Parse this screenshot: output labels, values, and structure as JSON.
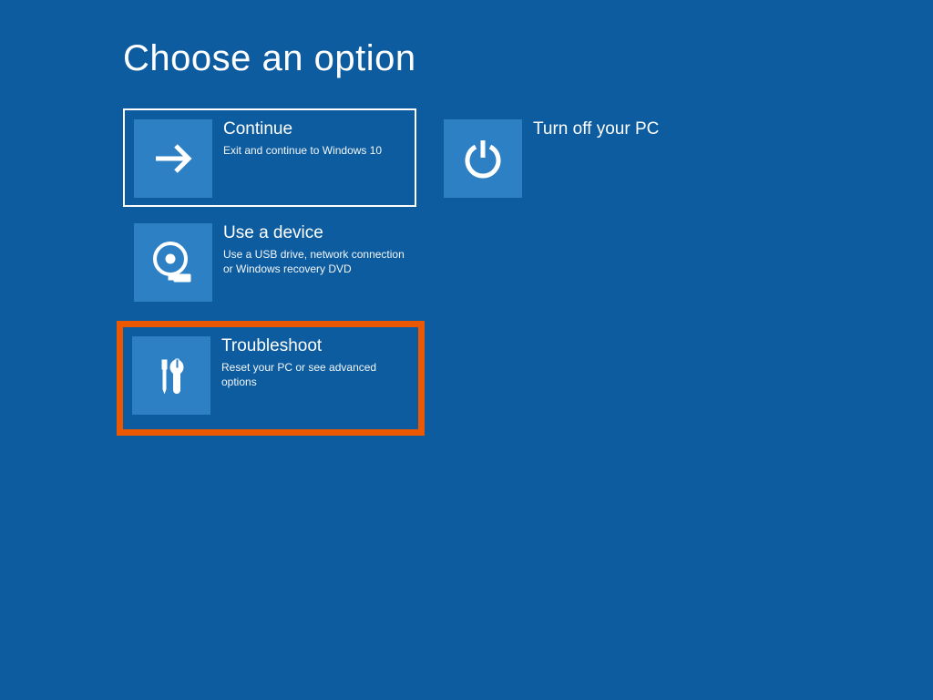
{
  "title": "Choose an option",
  "options": {
    "continue": {
      "title": "Continue",
      "desc": "Exit and continue to Windows 10"
    },
    "turn_off": {
      "title": "Turn off your PC",
      "desc": ""
    },
    "use_device": {
      "title": "Use a device",
      "desc": "Use a USB drive, network connection or Windows recovery DVD"
    },
    "troubleshoot": {
      "title": "Troubleshoot",
      "desc": "Reset your PC or see advanced options"
    }
  }
}
